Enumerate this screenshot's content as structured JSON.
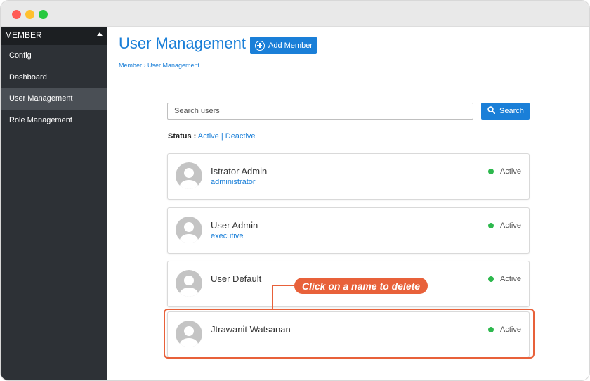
{
  "sidebar": {
    "header": "MEMBER",
    "items": [
      {
        "label": "Config"
      },
      {
        "label": "Dashboard"
      },
      {
        "label": "User Management"
      },
      {
        "label": "Role Management"
      }
    ]
  },
  "header": {
    "title": "User Management",
    "add_member_label": "Add Member",
    "breadcrumb": "Member › User Management"
  },
  "search": {
    "placeholder": "Search users",
    "button_label": "Search"
  },
  "status_filter": {
    "label": "Status :",
    "active": "Active",
    "separator": "|",
    "deactive": "Deactive"
  },
  "users": [
    {
      "name": "Istrator Admin",
      "role": "administrator",
      "status": "Active"
    },
    {
      "name": "User Admin",
      "role": "executive",
      "status": "Active"
    },
    {
      "name": "User Default",
      "role": "",
      "status": "Active"
    },
    {
      "name": "Jtrawanit Watsanan",
      "role": "",
      "status": "Active"
    }
  ],
  "callout": {
    "text": "Click on a name to delete"
  },
  "colors": {
    "accent": "#1a7fd8",
    "sidebar_bg": "#2d3136",
    "status_active": "#2db84d",
    "callout": "#e8613a"
  }
}
